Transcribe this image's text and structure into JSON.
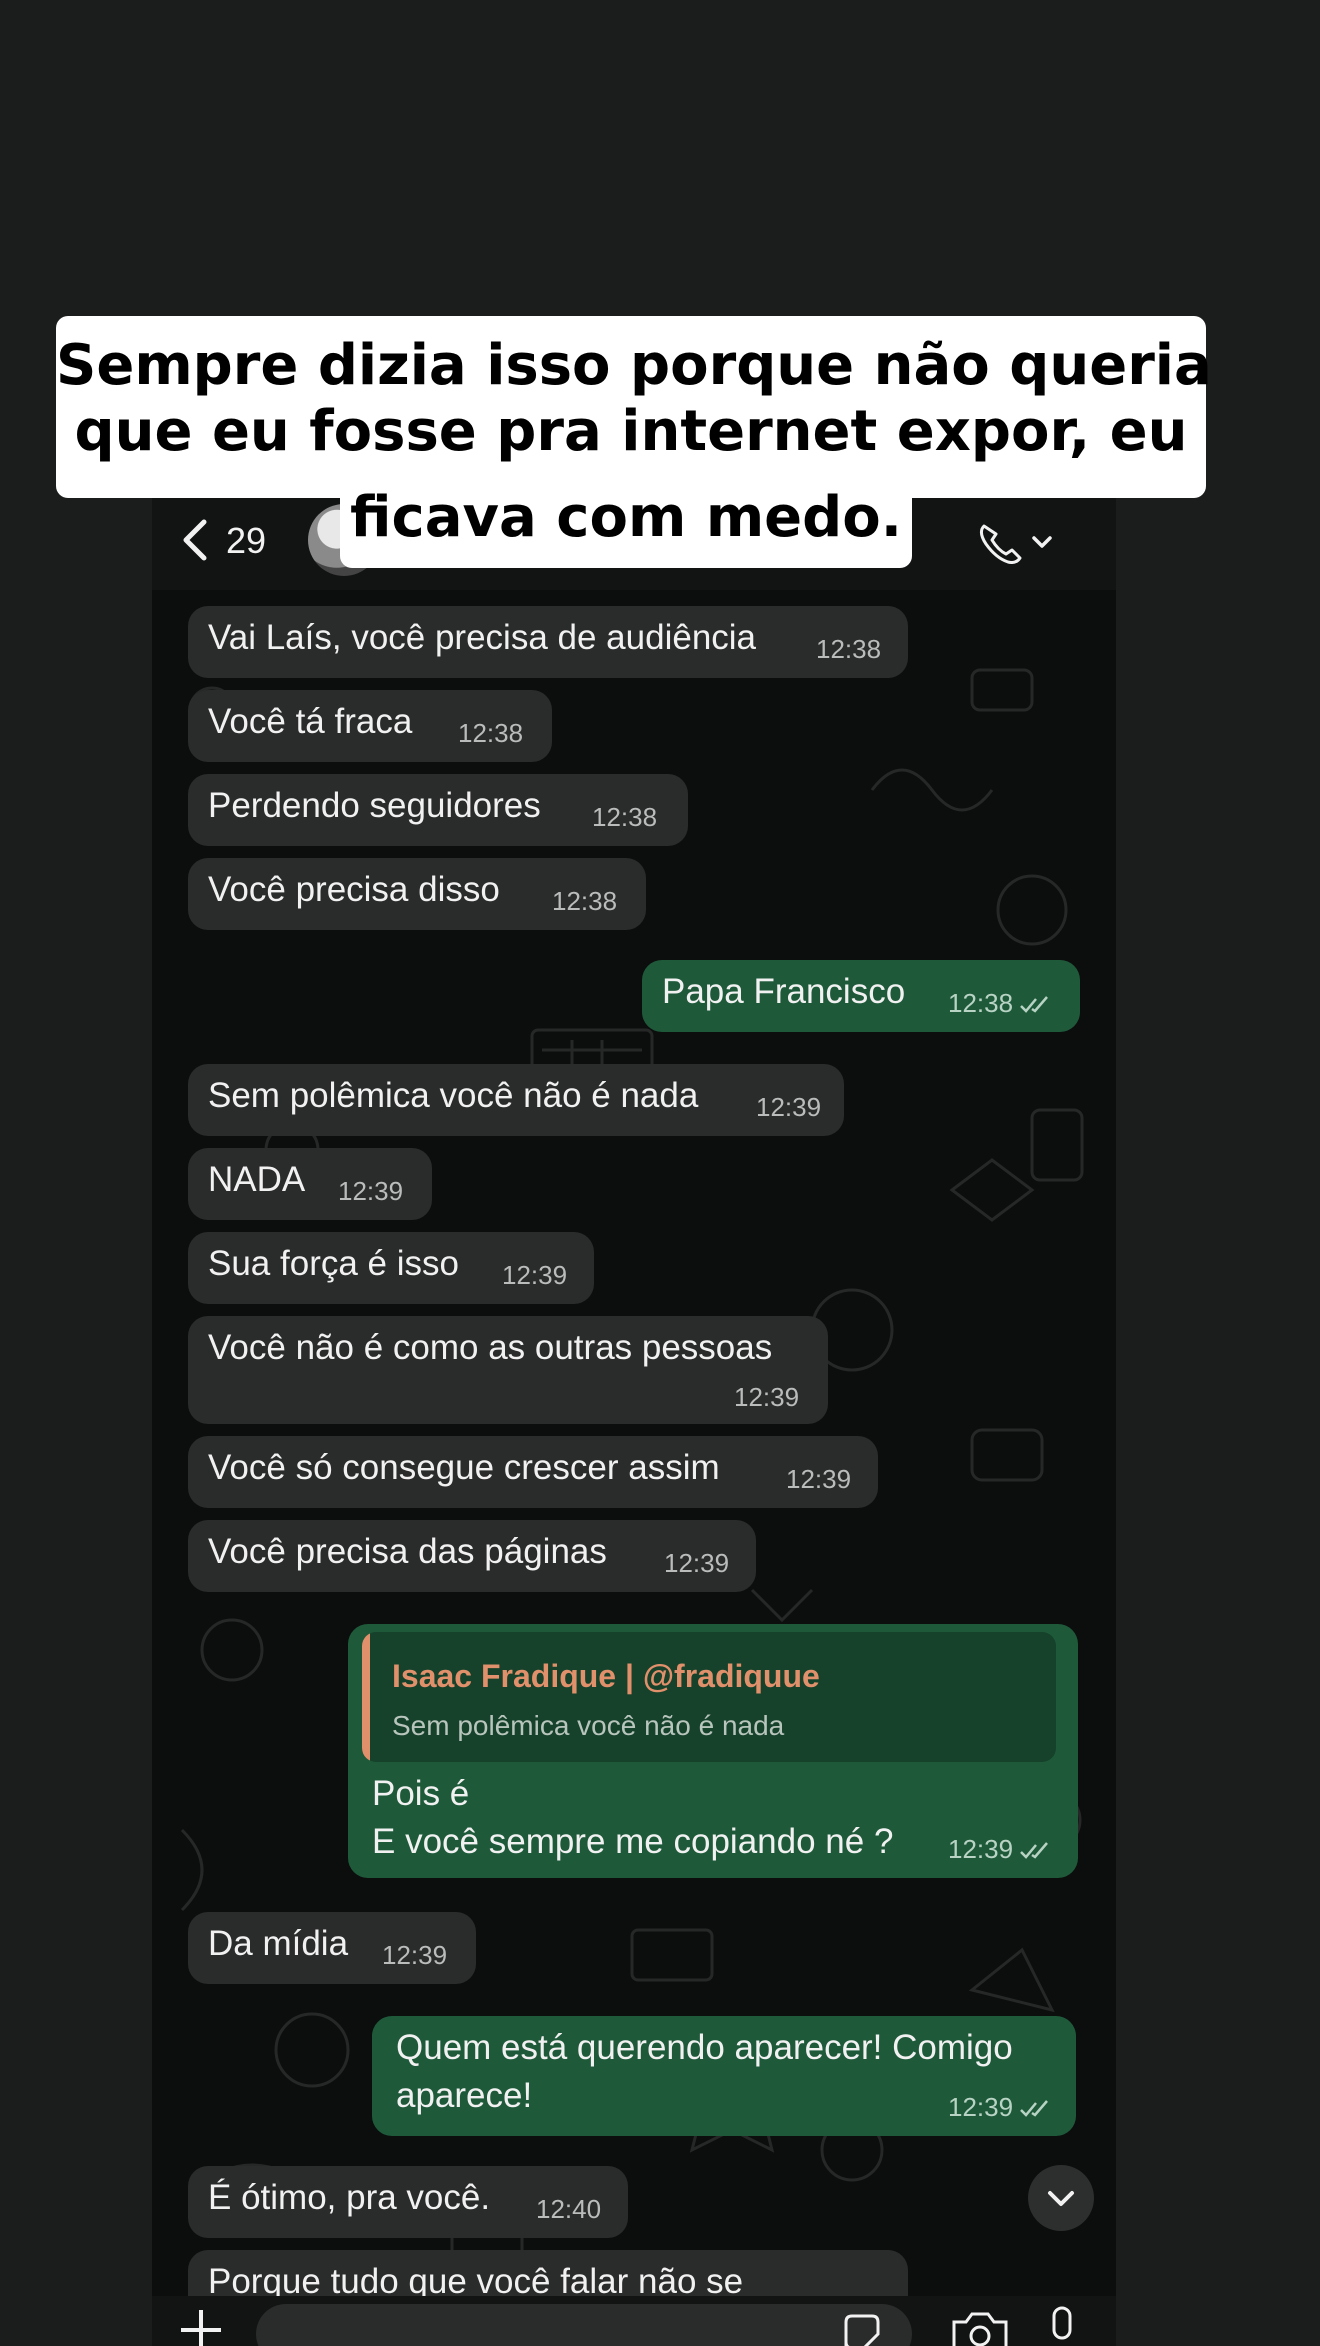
{
  "header": {
    "unread_count": "29"
  },
  "caption": {
    "line1": "Sempre dizia isso porque não queria",
    "line2": "que eu fosse pra internet expor, eu",
    "line3": "ficava com medo."
  },
  "messages": [
    {
      "dir": "in",
      "text": "Vai Laís, você precisa de audiência",
      "time": "12:38"
    },
    {
      "dir": "in",
      "text": "Você tá fraca",
      "time": "12:38"
    },
    {
      "dir": "in",
      "text": "Perdendo seguidores",
      "time": "12:38"
    },
    {
      "dir": "in",
      "text": "Você precisa disso",
      "time": "12:38"
    },
    {
      "dir": "out",
      "text": "Papa Francisco",
      "time": "12:38"
    },
    {
      "dir": "in",
      "text": "Sem polêmica você não é nada",
      "time": "12:39"
    },
    {
      "dir": "in",
      "text": "NADA",
      "time": "12:39"
    },
    {
      "dir": "in",
      "text": "Sua força é isso",
      "time": "12:39"
    },
    {
      "dir": "in",
      "text": "Você não é como as outras pessoas",
      "time": "12:39"
    },
    {
      "dir": "in",
      "text": "Você só consegue crescer assim",
      "time": "12:39"
    },
    {
      "dir": "in",
      "text": "Você precisa das páginas",
      "time": "12:39"
    },
    {
      "dir": "out",
      "reply_name": "Isaac Fradique | @fradiquue",
      "reply_text": "Sem polêmica você não é nada",
      "line1": "Pois é",
      "line2": "E você sempre me copiando né ?",
      "time": "12:39"
    },
    {
      "dir": "in",
      "text": "Da mídia",
      "time": "12:39"
    },
    {
      "dir": "out",
      "line1": "Quem está querendo aparecer! Comigo",
      "line2": "aparece!",
      "time": "12:39"
    },
    {
      "dir": "in",
      "text": "É ótimo, pra você.",
      "time": "12:40"
    },
    {
      "dir": "in",
      "text": "Porque tudo que você falar não se",
      "time": ""
    }
  ],
  "icons": {
    "back": "chevron-left-icon",
    "avatar": "avatar",
    "call": "phone-icon",
    "scroll": "chevron-down-icon",
    "add": "plus-icon",
    "sticker": "sticker-icon",
    "camera": "camera-icon",
    "mic": "microphone-icon",
    "read": "double-check-icon"
  },
  "colors": {
    "background": "#1b1c1c",
    "chat_bg": "#0c0d0d",
    "incoming": "#2a2b2b",
    "outgoing": "#1e5a3a",
    "reply_accent": "#e0906a",
    "caption_bg": "#ffffff"
  }
}
